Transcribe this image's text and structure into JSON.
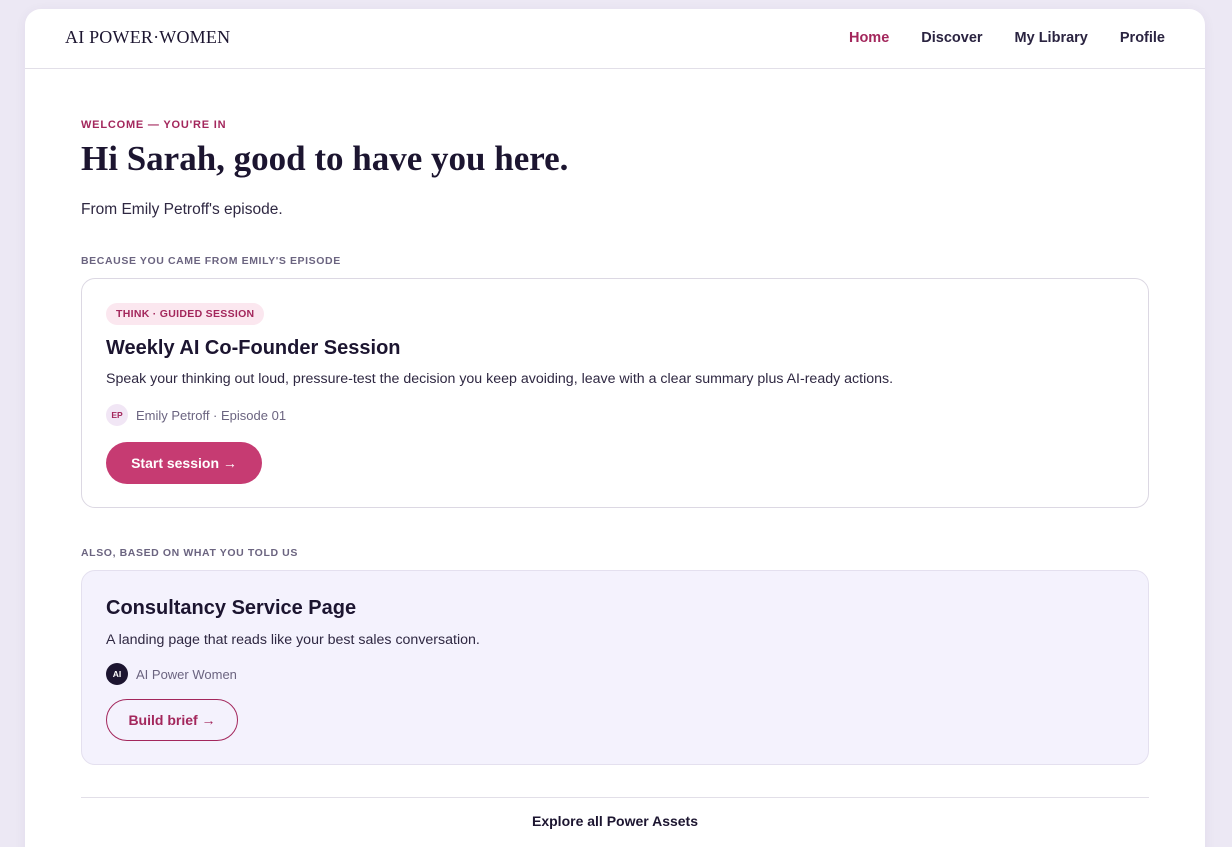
{
  "brand": {
    "logo": "AI POWER·WOMEN"
  },
  "nav": {
    "items": [
      {
        "label": "Home",
        "active": true
      },
      {
        "label": "Discover",
        "active": false
      },
      {
        "label": "My Library",
        "active": false
      },
      {
        "label": "Profile",
        "active": false
      }
    ]
  },
  "hero": {
    "eyebrow": "WELCOME — YOU'RE IN",
    "greeting": "Hi Sarah, good to have you here.",
    "subline": "From Emily Petroff's episode."
  },
  "featured": {
    "section_label": "BECAUSE YOU CAME FROM EMILY'S EPISODE",
    "tag": "THINK · GUIDED SESSION",
    "title": "Weekly AI Co-Founder Session",
    "description": "Speak your thinking out loud, pressure-test the decision you keep avoiding, leave with a clear summary plus AI-ready actions.",
    "author_initials": "EP",
    "author": "Emily Petroff · Episode 01",
    "cta": "Start session →"
  },
  "secondary": {
    "section_label": "ALSO, BASED ON WHAT YOU TOLD US",
    "title": "Consultancy Service Page",
    "description": "A landing page that reads like your best sales conversation.",
    "author_initials": "AI",
    "author": "AI Power Women",
    "cta": "Build brief →"
  },
  "footer": {
    "explore": "Explore all Power Assets"
  },
  "colors": {
    "accent": "#a3275c",
    "primary_button": "#c63b72",
    "page_bg": "#ece8f4",
    "alt_card_bg": "#f4f2fd"
  }
}
